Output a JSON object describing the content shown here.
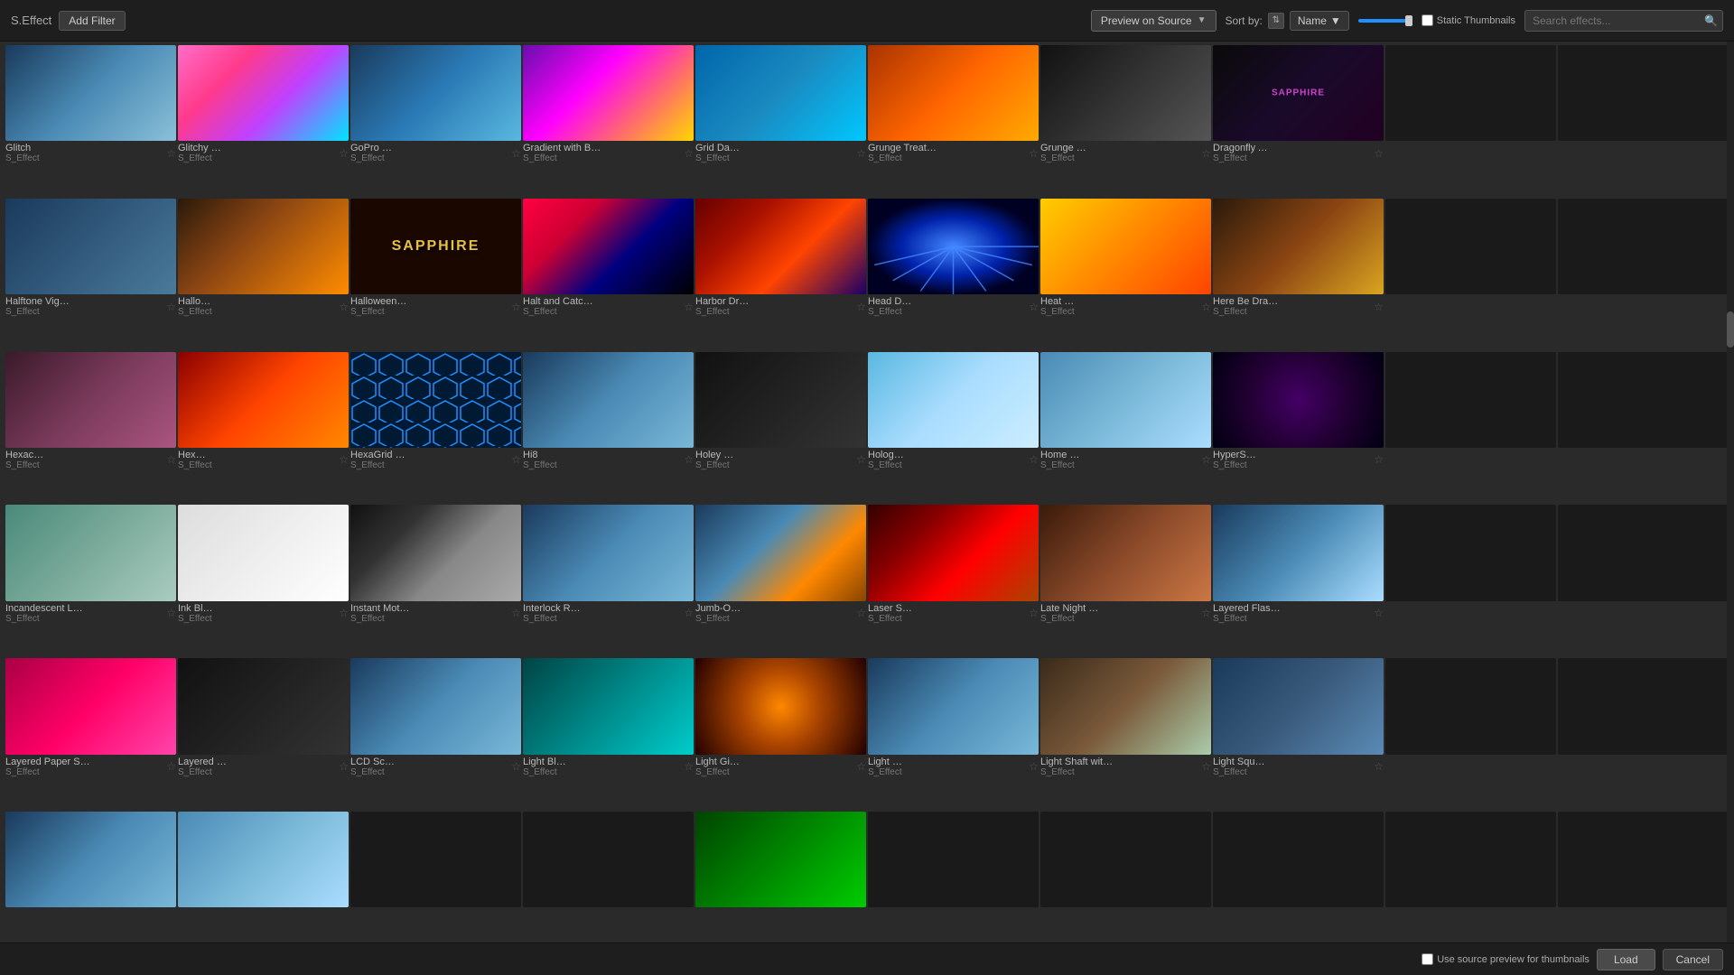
{
  "topbar": {
    "effect_label": "S.Effect",
    "add_filter": "Add Filter",
    "preview_btn": "Preview on Source",
    "sort_label": "Sort by:",
    "name_label": "Name",
    "static_thumb_label": "Static Thumbnails",
    "search_placeholder": "Search effects..."
  },
  "bottombar": {
    "use_source_label": "Use source preview for thumbnails",
    "ok_label": "Load",
    "cancel_label": "Cancel"
  },
  "grid": {
    "items": [
      {
        "name": "Glitch",
        "type": "S_Effect",
        "thumb": "t-glitch"
      },
      {
        "name": "Glitchy Sort",
        "type": "S_Effect",
        "thumb": "t-glitchy"
      },
      {
        "name": "GoPro Fixer",
        "type": "S_Effect",
        "thumb": "t-gopro"
      },
      {
        "name": "Gradient with Bokeh...",
        "type": "S_Effect",
        "thumb": "t-gradient"
      },
      {
        "name": "Grid Damage",
        "type": "S_Effect",
        "thumb": "t-grid-damage"
      },
      {
        "name": "Grunge Treatment",
        "type": "S_Effect",
        "thumb": "t-grunge"
      },
      {
        "name": "Grunge Wall",
        "type": "S_Effect",
        "thumb": "t-grunge-wall"
      },
      {
        "name": "Dragonfly Alpha",
        "type": "S_Effect",
        "thumb": "t-dragonfly"
      },
      {
        "name": "",
        "type": "",
        "thumb": ""
      },
      {
        "name": "",
        "type": "",
        "thumb": ""
      },
      {
        "name": "Halftone Vignette",
        "type": "S_Effect",
        "thumb": "t-halftone"
      },
      {
        "name": "Halloween",
        "type": "S_Effect",
        "thumb": "t-halloween"
      },
      {
        "name": "Halloween Text",
        "type": "S_Effect",
        "thumb": "t-sapphire-text"
      },
      {
        "name": "Halt and Catch Fire",
        "type": "S_Effect",
        "thumb": "t-halt"
      },
      {
        "name": "Harbor Dreams",
        "type": "S_Effect",
        "thumb": "t-harbor"
      },
      {
        "name": "Head Dress",
        "type": "S_Effect",
        "thumb": "t-head-dress"
      },
      {
        "name": "Heat Haze",
        "type": "S_Effect",
        "thumb": "t-heat-haze"
      },
      {
        "name": "Here Be Dragons",
        "type": "S_Effect",
        "thumb": "t-here-be"
      },
      {
        "name": "",
        "type": "",
        "thumb": ""
      },
      {
        "name": "",
        "type": "",
        "thumb": ""
      },
      {
        "name": "Hexacubes",
        "type": "S_Effect",
        "thumb": "t-hexacubes"
      },
      {
        "name": "Hexaflux",
        "type": "S_Effect",
        "thumb": "t-hexaflux"
      },
      {
        "name": "HexaGrid Echo",
        "type": "S_Effect",
        "thumb": "t-hexagrid"
      },
      {
        "name": "Hi8",
        "type": "S_Effect",
        "thumb": "t-hi8"
      },
      {
        "name": "Holey Wall",
        "type": "S_Effect",
        "thumb": "t-holey-wall"
      },
      {
        "name": "Hologram",
        "type": "S_Effect",
        "thumb": "t-hologram"
      },
      {
        "name": "Home Movie",
        "type": "S_Effect",
        "thumb": "t-home-movie"
      },
      {
        "name": "HyperSpace",
        "type": "S_Effect",
        "thumb": "t-hyperspace"
      },
      {
        "name": "",
        "type": "",
        "thumb": ""
      },
      {
        "name": "",
        "type": "",
        "thumb": ""
      },
      {
        "name": "Incandescent Light...",
        "type": "S_Effect",
        "thumb": "t-incandescent"
      },
      {
        "name": "Ink Blotch",
        "type": "S_Effect",
        "thumb": "t-ink"
      },
      {
        "name": "Instant Motion...",
        "type": "S_Effect",
        "thumb": "t-instant-motion"
      },
      {
        "name": "Interlock Reveal",
        "type": "S_Effect",
        "thumb": "t-interlock"
      },
      {
        "name": "Jumb-O-tron",
        "type": "S_Effect",
        "thumb": "t-jumb"
      },
      {
        "name": "Laser Show",
        "type": "S_Effect",
        "thumb": "t-laser"
      },
      {
        "name": "Late Night Haze",
        "type": "S_Effect",
        "thumb": "t-late-night"
      },
      {
        "name": "Layered Flashbulb",
        "type": "S_Effect",
        "thumb": "t-layered-flash"
      },
      {
        "name": "",
        "type": "",
        "thumb": ""
      },
      {
        "name": "",
        "type": "",
        "thumb": ""
      },
      {
        "name": "Layered Paper Shreds",
        "type": "S_Effect",
        "thumb": "t-layered-paper"
      },
      {
        "name": "Layered Rain",
        "type": "S_Effect",
        "thumb": "t-layered-rain"
      },
      {
        "name": "LCD Screen",
        "type": "S_Effect",
        "thumb": "t-lcd"
      },
      {
        "name": "Light Blocks",
        "type": "S_Effect",
        "thumb": "t-light-blocks"
      },
      {
        "name": "Light Gizmo",
        "type": "S_Effect",
        "thumb": "t-light-gizmo"
      },
      {
        "name": "Light Pegs",
        "type": "S_Effect",
        "thumb": "t-light-pegs"
      },
      {
        "name": "Light Shaft with Dust",
        "type": "S_Effect",
        "thumb": "t-light-shaft"
      },
      {
        "name": "Light Squares",
        "type": "S_Effect",
        "thumb": "t-light-squares"
      },
      {
        "name": "",
        "type": "",
        "thumb": ""
      },
      {
        "name": "",
        "type": "",
        "thumb": ""
      },
      {
        "name": "",
        "type": "",
        "thumb": "t-partial3"
      },
      {
        "name": "",
        "type": "",
        "thumb": "t-partial2"
      },
      {
        "name": "",
        "type": "",
        "thumb": ""
      },
      {
        "name": "",
        "type": "",
        "thumb": ""
      },
      {
        "name": "",
        "type": "",
        "thumb": "t-partial"
      },
      {
        "name": "",
        "type": "",
        "thumb": ""
      },
      {
        "name": "",
        "type": "",
        "thumb": ""
      },
      {
        "name": "",
        "type": "",
        "thumb": ""
      },
      {
        "name": "",
        "type": "",
        "thumb": ""
      },
      {
        "name": "",
        "type": "",
        "thumb": ""
      }
    ]
  }
}
